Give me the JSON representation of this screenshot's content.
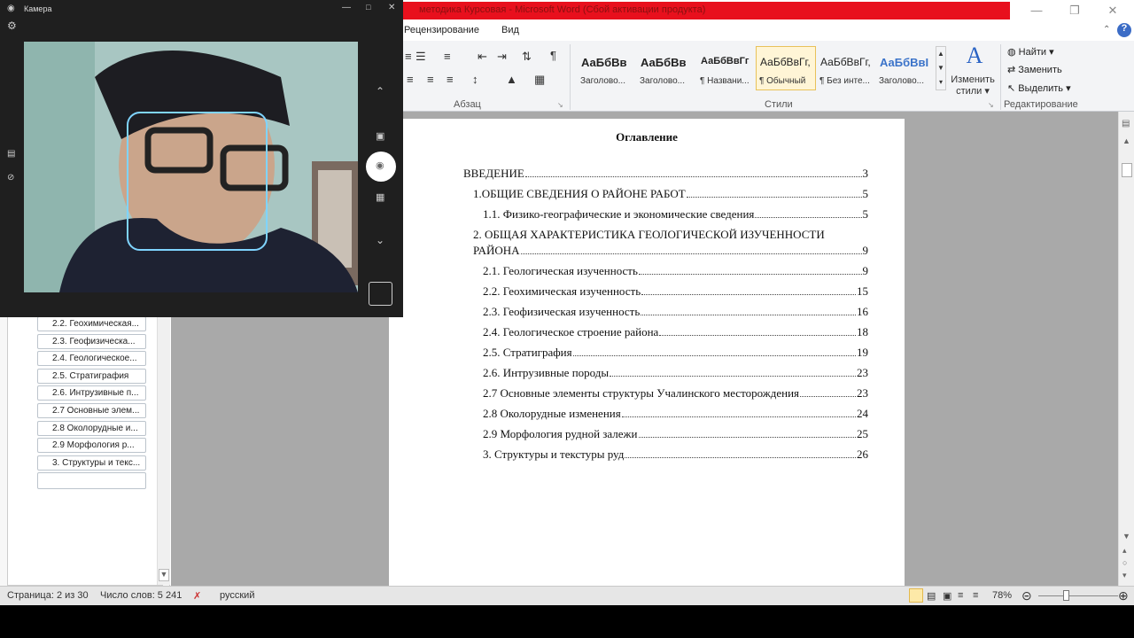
{
  "title_bar": {
    "title": "методика Курсовая - Microsoft Word (Сбой активации продукта)"
  },
  "ribbon": {
    "tabs": [
      "Рецензирование",
      "Вид"
    ],
    "groups": {
      "paragraph": "Абзац",
      "styles": "Стили",
      "editing": "Редактирование"
    },
    "styles": [
      {
        "sample": "АаБбВв",
        "name": "Заголово..."
      },
      {
        "sample": "АаБбВв",
        "name": "Заголово..."
      },
      {
        "sample": "АаБбВвГг",
        "name": "¶ Названи..."
      },
      {
        "sample": "АаБбВвГг,",
        "name": "¶ Обычный",
        "selected": true
      },
      {
        "sample": "АаБбВвГг,",
        "name": "¶ Без инте..."
      },
      {
        "sample": "АаБбВвI",
        "name": "Заголово..."
      }
    ],
    "change_styles": {
      "line1": "Изменить",
      "line2": "стили"
    },
    "editing": {
      "find": "Найти",
      "replace": "Заменить",
      "select": "Выделить"
    }
  },
  "nav_pane": {
    "items": [
      "2.2. Геохимическая...",
      "2.3. Геофизическа...",
      "2.4. Геологическое...",
      "2.5. Стратиграфия",
      "2.6. Интрузивные п...",
      "2.7 Основные элем...",
      "2.8 Околорудные и...",
      "2.9 Морфология р...",
      "3. Структуры и текс...",
      ""
    ]
  },
  "document": {
    "title": "Оглавление",
    "toc": [
      {
        "text": "ВВЕДЕНИЕ",
        "page": "3"
      },
      {
        "text": "1.ОБЩИЕ СВЕДЕНИЯ О РАЙОНЕ РАБОТ",
        "page": "5"
      },
      {
        "text": "1.1. Физико-географические и экономические сведения",
        "page": "5"
      },
      {
        "text": "2. ОБЩАЯ ХАРАКТЕРИСТИКА ГЕОЛОГИЧЕСКОЙ ИЗУЧЕННОСТИ",
        "text2": "РАЙОНА",
        "page": "9"
      },
      {
        "text": "2.1. Геологическая изученность",
        "page": "9"
      },
      {
        "text": "2.2. Геохимическая изученность",
        "page": "15"
      },
      {
        "text": "2.3. Геофизическая изученность",
        "page": "16"
      },
      {
        "text": "2.4. Геологическое строение района",
        "page": "18"
      },
      {
        "text": "2.5. Стратиграфия",
        "page": "19"
      },
      {
        "text": "2.6. Интрузивные породы",
        "page": "23"
      },
      {
        "text": "2.7 Основные элементы структуры Учалинского месторождения",
        "page": "23"
      },
      {
        "text": "2.8 Околорудные изменения",
        "page": "24"
      },
      {
        "text": "2.9 Морфология рудной залежи",
        "page": "25"
      },
      {
        "text": "3. Структуры и текстуры руд",
        "page": "26"
      }
    ]
  },
  "status_bar": {
    "page": "Страница: 2 из 30",
    "words": "Число слов: 5 241",
    "language": "русский",
    "zoom": "78%"
  },
  "camera": {
    "title": "Камера"
  },
  "colors": {
    "title_red": "#e8101d",
    "camera_bg": "#1f1f1f",
    "face_frame": "#7fd4ff"
  }
}
